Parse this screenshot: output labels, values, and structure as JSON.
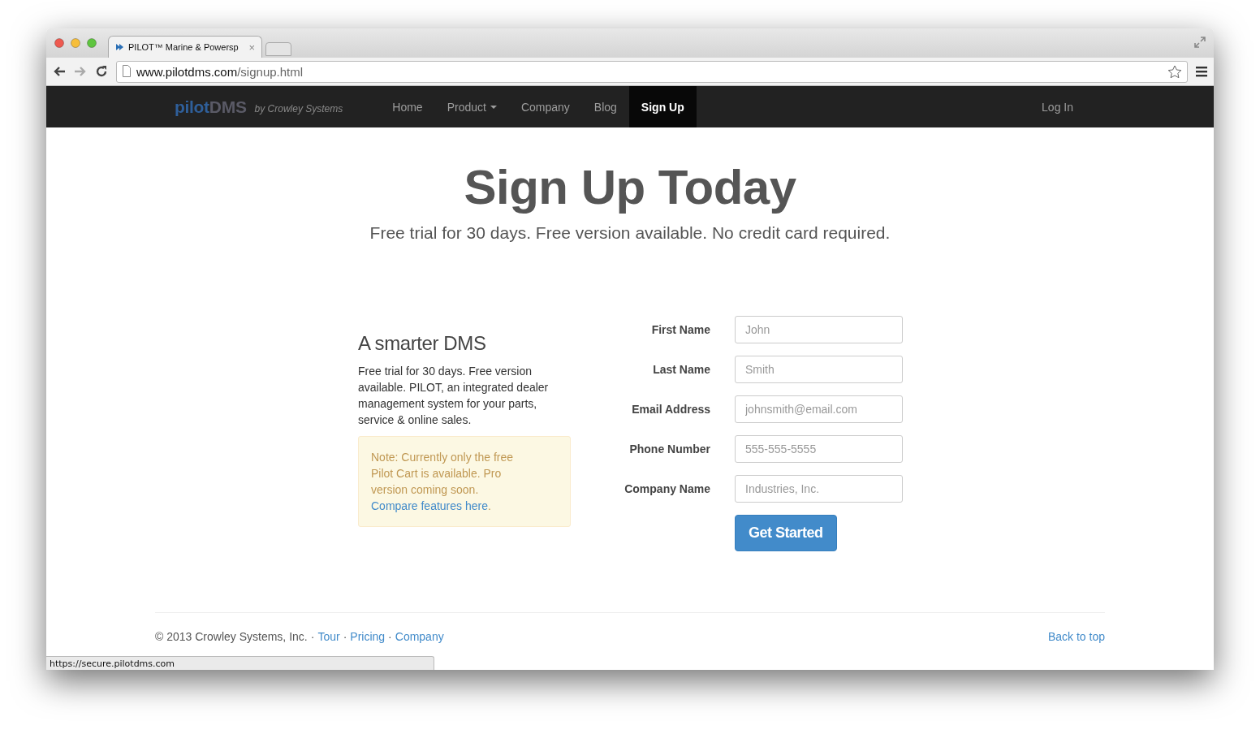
{
  "browser": {
    "tab_title": "PILOT™ Marine & Powersp",
    "tab_close": "×",
    "url_host": "www.pilotdms.com",
    "url_path": "/signup.html",
    "status_url": "https://secure.pilotdms.com"
  },
  "navbar": {
    "logo_main": "pilot",
    "logo_accent": "DMS",
    "tagline": "by Crowley Systems",
    "items": [
      {
        "label": "Home",
        "selected": false,
        "has_menu": false
      },
      {
        "label": "Product",
        "selected": false,
        "has_menu": true
      },
      {
        "label": "Company",
        "selected": false,
        "has_menu": false
      },
      {
        "label": "Blog",
        "selected": false,
        "has_menu": false
      },
      {
        "label": "Sign Up",
        "selected": true,
        "has_menu": false
      }
    ],
    "login": "Log In"
  },
  "hero": {
    "title": "Sign Up Today",
    "subtitle": "Free trial for 30 days. Free version available. No credit card required."
  },
  "intro": {
    "heading": "A smarter DMS",
    "text": "Free trial for 30 days. Free version available. PILOT, an integrated dealer management system for your parts, service & online sales.",
    "note": {
      "text": "Note: Currently only the free Pilot Cart is available. Pro version coming soon.",
      "link": "Compare features here",
      "after": "."
    }
  },
  "form": {
    "fields": [
      {
        "label": "First Name",
        "placeholder": "John"
      },
      {
        "label": "Last Name",
        "placeholder": "Smith"
      },
      {
        "label": "Email Address",
        "placeholder": "johnsmith@email.com"
      },
      {
        "label": "Phone Number",
        "placeholder": "555-555-5555"
      },
      {
        "label": "Company Name",
        "placeholder": "Industries, Inc."
      }
    ],
    "submit": "Get Started"
  },
  "footer": {
    "copyright": "© 2013 Crowley Systems, Inc.",
    "separator": "·",
    "links": [
      "Tour",
      "Pricing",
      "Company"
    ],
    "back_to_top": "Back to top"
  }
}
